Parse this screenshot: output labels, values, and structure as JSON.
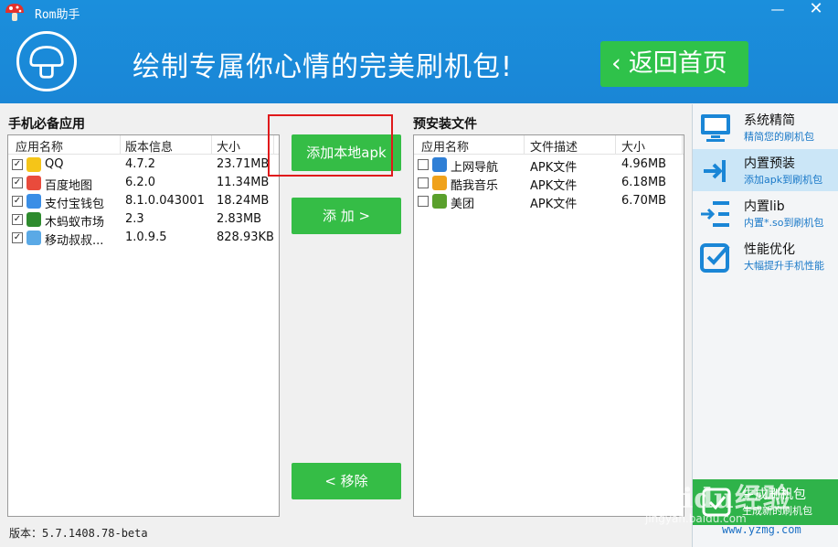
{
  "window": {
    "title": "Rom助手",
    "minimize_glyph": "—",
    "close_glyph": "✕"
  },
  "banner": {
    "text": "绘制专属你心情的完美刷机包!",
    "back_home_label": "返回首页"
  },
  "left_panel": {
    "title": "手机必备应用",
    "columns": [
      "应用名称",
      "版本信息",
      "大小"
    ],
    "rows": [
      {
        "name": "QQ",
        "version": "4.7.2",
        "size": "23.71MB",
        "checked": true,
        "icon": "qq-icon",
        "color": "#f5c518"
      },
      {
        "name": "百度地图",
        "version": "6.2.0",
        "size": "11.34MB",
        "checked": true,
        "icon": "baidu-map-icon",
        "color": "#e94b3c"
      },
      {
        "name": "支付宝钱包",
        "version": "8.1.0.043001",
        "size": "18.24MB",
        "checked": true,
        "icon": "alipay-icon",
        "color": "#3a8ee6"
      },
      {
        "name": "木蚂蚁市场",
        "version": "2.3",
        "size": "2.83MB",
        "checked": true,
        "icon": "mumayi-icon",
        "color": "#2e8b2e"
      },
      {
        "name": "移动叔叔...",
        "version": "1.0.9.5",
        "size": "828.93KB",
        "checked": true,
        "icon": "uncle-icon",
        "color": "#5aa9e6"
      }
    ]
  },
  "middle": {
    "add_local_label": "添加本地apk",
    "add_label": "添 加 >",
    "remove_label": "< 移除"
  },
  "right_panel": {
    "title": "预安装文件",
    "columns": [
      "应用名称",
      "文件描述",
      "大小"
    ],
    "rows": [
      {
        "name": "上网导航",
        "desc": "APK文件",
        "size": "4.96MB",
        "checked": false,
        "icon": "nav-icon",
        "color": "#2f7fd6"
      },
      {
        "name": "酷我音乐",
        "desc": "APK文件",
        "size": "6.18MB",
        "checked": false,
        "icon": "kuwo-icon",
        "color": "#f0a21b"
      },
      {
        "name": "美团",
        "desc": "APK文件",
        "size": "6.70MB",
        "checked": false,
        "icon": "meituan-icon",
        "color": "#5aa02c"
      }
    ]
  },
  "side_menu": {
    "items": [
      {
        "title": "系统精简",
        "sub": "精简您的刷机包",
        "icon": "monitor-icon",
        "active": false
      },
      {
        "title": "内置预装",
        "sub": "添加apk到刷机包",
        "icon": "import-icon",
        "active": true
      },
      {
        "title": "内置lib",
        "sub": "内置*.so到刷机包",
        "icon": "list-import-icon",
        "active": false
      },
      {
        "title": "性能优化",
        "sub": "大幅提升手机性能",
        "icon": "checkbox-icon",
        "active": false
      }
    ],
    "bottom": {
      "title": "生成刷机包",
      "sub": "生成新的刷机包"
    }
  },
  "footer": {
    "version": "版本：5.7.1408.78-beta",
    "site": "www.yzmg.com"
  },
  "watermark": {
    "text": "Baidu经验",
    "sub": "jingyan.baidu.com"
  },
  "colors": {
    "header_blue": "#1a88d8",
    "button_green": "#35bd46",
    "highlight_red": "#e0191b",
    "side_active": "#cbe6f7"
  }
}
